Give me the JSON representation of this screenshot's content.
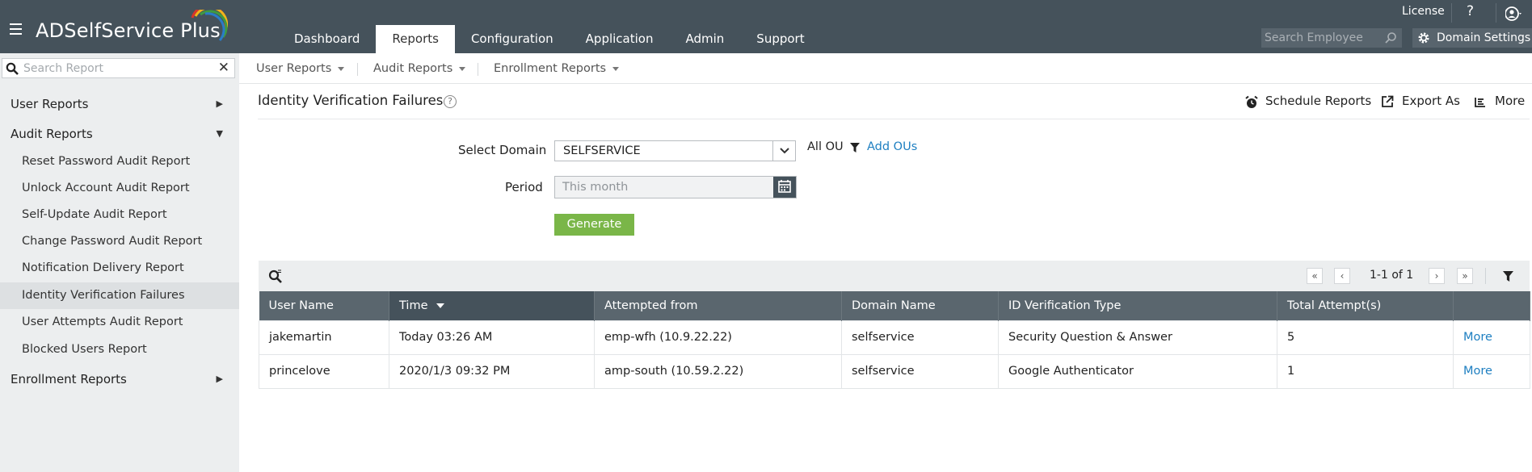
{
  "app": {
    "title": "ADSelfService Plus"
  },
  "topbar": {
    "nav_tabs": [
      {
        "label": "Dashboard"
      },
      {
        "label": "Reports"
      },
      {
        "label": "Configuration"
      },
      {
        "label": "Application"
      },
      {
        "label": "Admin"
      },
      {
        "label": "Support"
      }
    ],
    "active_tab": "Reports",
    "license_label": "License",
    "help_label": "?",
    "search_placeholder": "Search Employee",
    "domain_settings_label": "Domain Settings",
    "bar_color": "#45525b"
  },
  "sidebar": {
    "search_placeholder": "Search Report",
    "clear_label": "✕",
    "categories": [
      {
        "label": "User Reports",
        "state": "collapsed"
      },
      {
        "label": "Audit Reports",
        "state": "expanded"
      },
      {
        "label": "Enrollment Reports",
        "state": "collapsed"
      }
    ],
    "audit_items": [
      {
        "label": "Reset Password Audit Report"
      },
      {
        "label": "Unlock Account Audit Report"
      },
      {
        "label": "Self-Update Audit Report"
      },
      {
        "label": "Change Password Audit Report"
      },
      {
        "label": "Notification Delivery Report"
      },
      {
        "label": "Identity Verification Failures"
      },
      {
        "label": "User Attempts Audit Report"
      },
      {
        "label": "Blocked Users Report"
      }
    ],
    "active_item": "Identity Verification Failures"
  },
  "subnav": {
    "items": [
      {
        "label": "User Reports"
      },
      {
        "label": "Audit Reports"
      },
      {
        "label": "Enrollment Reports"
      }
    ]
  },
  "page": {
    "title": "Identity Verification Failures",
    "help": "?",
    "actions": {
      "schedule": "Schedule Reports",
      "export": "Export As",
      "more": "More"
    }
  },
  "form": {
    "domain_label": "Select Domain",
    "domain_value": "SELFSERVICE",
    "all_ou": "All OU",
    "add_ous": "Add OUs",
    "period_label": "Period",
    "period_value": "This month",
    "generate_label": "Generate",
    "generate_color": "#7ab648"
  },
  "pagination": {
    "first": "«",
    "prev": "‹",
    "range_text": "1-1 of 1",
    "next": "›",
    "last": "»"
  },
  "table": {
    "columns": [
      "User Name",
      "Time",
      "Attempted from",
      "Domain Name",
      "ID Verification Type",
      "Total Attempt(s)",
      ""
    ],
    "sorted_column": "Time",
    "rows": [
      {
        "user": "jakemartin",
        "time": "Today 03:26 AM",
        "from": "emp-wfh (10.9.22.22)",
        "domain": "selfservice",
        "type": "Security Question & Answer",
        "attempts": "5",
        "more": "More"
      },
      {
        "user": "princelove",
        "time": "2020/1/3 09:32 PM",
        "from": "amp-south (10.59.2.22)",
        "domain": "selfservice",
        "type": "Google Authenticator",
        "attempts": "1",
        "more": "More"
      }
    ],
    "link_color": "#1e7fc1"
  }
}
